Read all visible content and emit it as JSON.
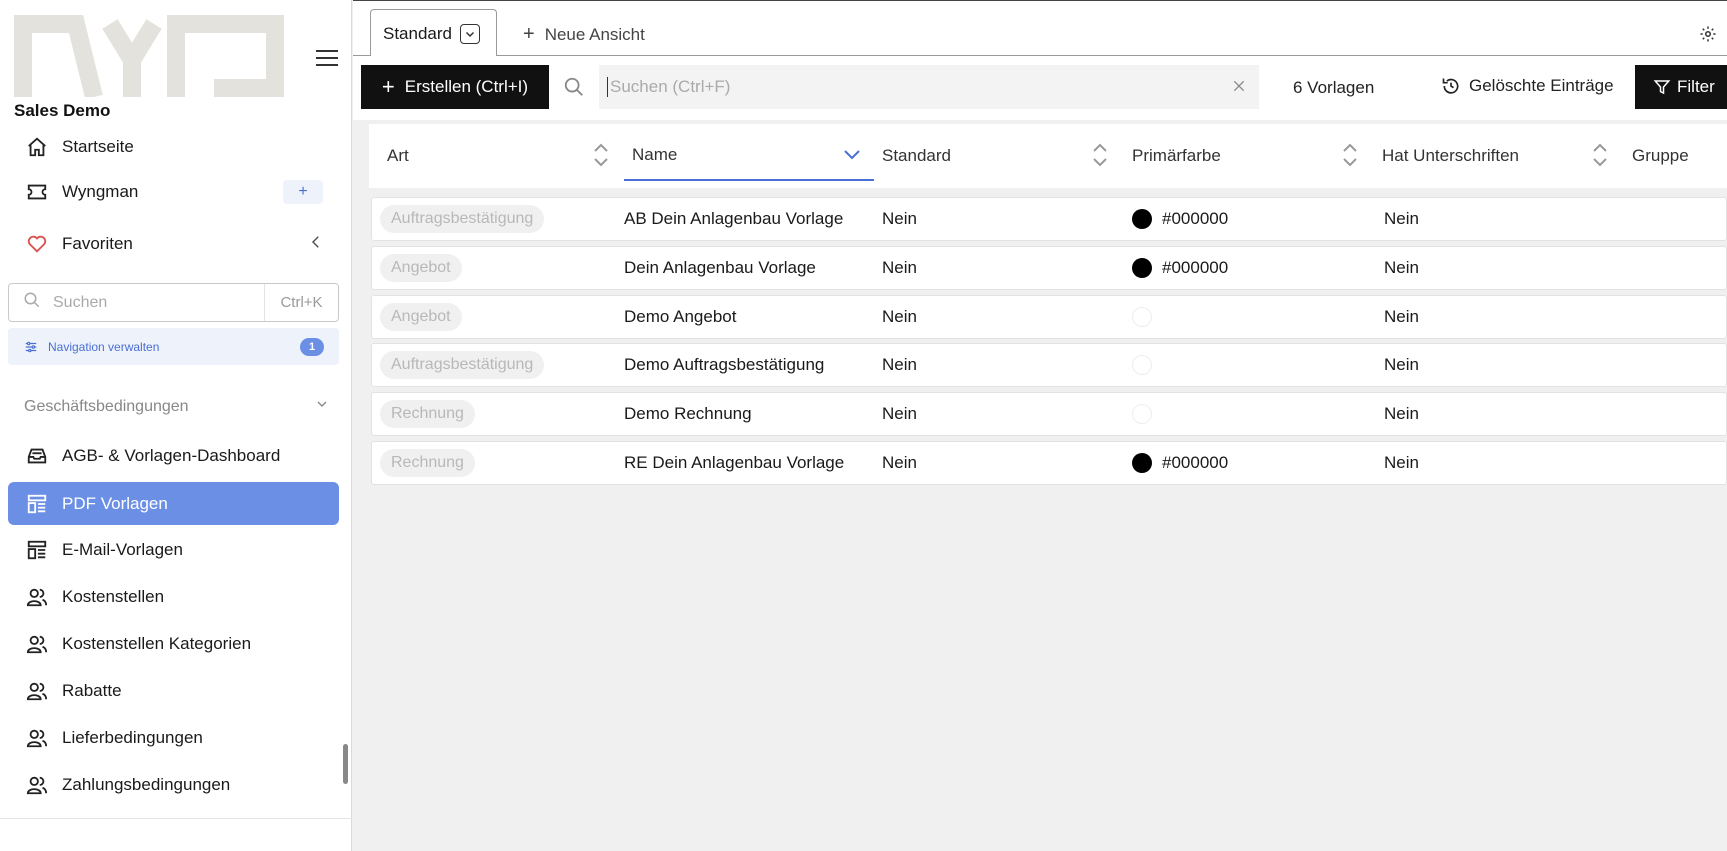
{
  "sidebar": {
    "org_name": "Sales Demo",
    "top_items": [
      {
        "label": "Startseite",
        "icon": "home-icon"
      },
      {
        "label": "Wyngman",
        "icon": "ticket-icon"
      },
      {
        "label": "Favoriten",
        "icon": "heart-icon"
      }
    ],
    "search": {
      "placeholder": "Suchen",
      "shortcut": "Ctrl+K"
    },
    "manage_nav": {
      "label": "Navigation verwalten",
      "badge": "1"
    },
    "group": {
      "label": "Geschäftsbedingungen"
    },
    "group_items": [
      {
        "label": "AGB- & Vorlagen-Dashboard",
        "icon": "inbox-icon"
      },
      {
        "label": "PDF Vorlagen",
        "icon": "template-icon",
        "active": true
      },
      {
        "label": "E-Mail-Vorlagen",
        "icon": "template-icon"
      },
      {
        "label": "Kostenstellen",
        "icon": "users-icon"
      },
      {
        "label": "Kostenstellen Kategorien",
        "icon": "users-icon"
      },
      {
        "label": "Rabatte",
        "icon": "users-icon"
      },
      {
        "label": "Lieferbedingungen",
        "icon": "users-icon"
      },
      {
        "label": "Zahlungsbedingungen",
        "icon": "users-icon"
      }
    ]
  },
  "tabs": {
    "active": "Standard",
    "new_view": "Neue Ansicht"
  },
  "toolbar": {
    "create_label": "Erstellen (Ctrl+I)",
    "search_placeholder": "Suchen (Ctrl+F)",
    "count": "6 Vorlagen",
    "deleted_label": "Gelöschte Einträge",
    "filter_label": "Filter"
  },
  "table": {
    "columns": [
      "Art",
      "Name",
      "Standard",
      "Primärfarbe",
      "Hat Unterschriften",
      "Gruppe"
    ],
    "sorted_column": "Name",
    "rows": [
      {
        "art": "Auftragsbestätigung",
        "name": "AB Dein Anlagenbau Vorlage",
        "standard": "Nein",
        "color": "#000000",
        "signatures": "Nein"
      },
      {
        "art": "Angebot",
        "name": "Dein Anlagenbau Vorlage",
        "standard": "Nein",
        "color": "#000000",
        "signatures": "Nein"
      },
      {
        "art": "Angebot",
        "name": "Demo Angebot",
        "standard": "Nein",
        "color": "",
        "signatures": "Nein"
      },
      {
        "art": "Auftragsbestätigung",
        "name": "Demo Auftragsbestätigung",
        "standard": "Nein",
        "color": "",
        "signatures": "Nein"
      },
      {
        "art": "Rechnung",
        "name": "Demo Rechnung",
        "standard": "Nein",
        "color": "",
        "signatures": "Nein"
      },
      {
        "art": "Rechnung",
        "name": "RE Dein Anlagenbau Vorlage",
        "standard": "Nein",
        "color": "#000000",
        "signatures": "Nein"
      }
    ]
  },
  "colors": {
    "accent": "#6c8fe6",
    "dark": "#111111"
  }
}
